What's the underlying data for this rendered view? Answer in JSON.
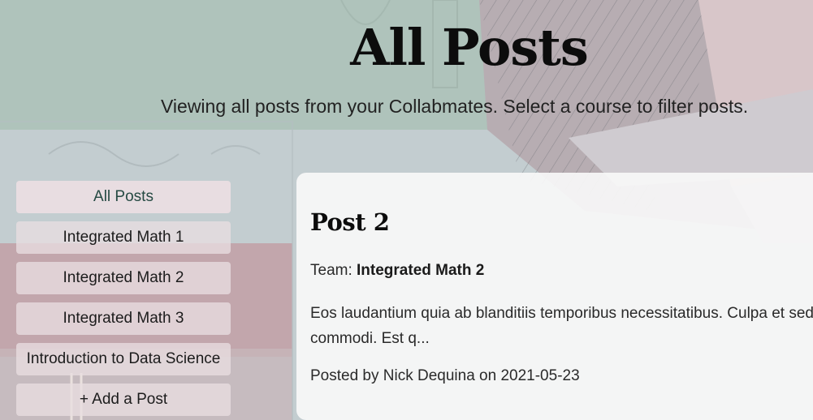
{
  "header": {
    "title": "All Posts",
    "subtitle": "Viewing all posts from your Collabmates. Select a course to filter posts."
  },
  "sidebar": {
    "items": [
      {
        "label": "All Posts",
        "active": true
      },
      {
        "label": "Integrated Math 1",
        "active": false
      },
      {
        "label": "Integrated Math 2",
        "active": false
      },
      {
        "label": "Integrated Math 3",
        "active": false
      },
      {
        "label": "Introduction to Data Science",
        "active": false
      },
      {
        "label": "+ Add a Post",
        "active": false
      }
    ]
  },
  "posts": [
    {
      "title": "Post 2",
      "team_label": "Team:",
      "team": "Integrated Math 2",
      "body": "Eos laudantium quia ab blanditiis temporibus necessitatibus. Culpa et sed commodi. Est q...",
      "meta": "Posted by Nick Dequina on 2021-05-23"
    }
  ],
  "colors": {
    "accent_text": "#264a43",
    "button_bg": "#e8dee0",
    "card_bg": "#f7f7f7"
  }
}
